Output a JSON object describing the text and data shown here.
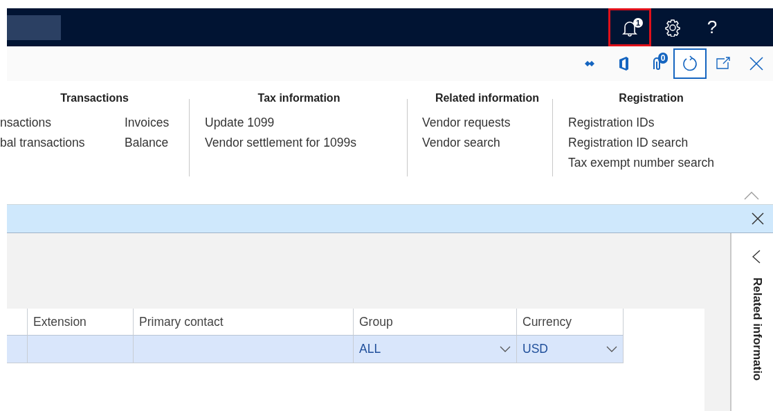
{
  "nav_bar": {
    "buttons": [
      {
        "kind": "notifications",
        "badge": "1",
        "highlighted": true
      },
      {
        "kind": "settings",
        "highlighted": false
      },
      {
        "kind": "help",
        "label": "?",
        "highlighted": false
      }
    ]
  },
  "action_bar": {
    "buttons": [
      {
        "kind": "diamond",
        "focused": false
      },
      {
        "kind": "office",
        "focused": false
      },
      {
        "kind": "attachments",
        "badge": "0",
        "focused": false
      },
      {
        "kind": "refresh",
        "focused": true
      },
      {
        "kind": "popout",
        "focused": false
      },
      {
        "kind": "close",
        "focused": false
      }
    ]
  },
  "menu": {
    "groups": [
      {
        "title": "Transactions",
        "columns": [
          [
            "nsactions",
            "bal transactions"
          ],
          [
            "Invoices",
            "Balance"
          ]
        ]
      },
      {
        "title": "Tax information",
        "columns": [
          [
            "Update 1099",
            "Vendor settlement for 1099s"
          ]
        ]
      },
      {
        "title": "Related information",
        "columns": [
          [
            "Vendor requests",
            "Vendor search"
          ]
        ]
      },
      {
        "title": "Registration",
        "columns": [
          [
            "Registration IDs",
            "Registration ID search",
            "Tax exempt number search"
          ]
        ]
      }
    ],
    "expanded": true
  },
  "message_bar": {
    "closable": true
  },
  "grid": {
    "columns": [
      {},
      {
        "label": "Extension"
      },
      {
        "label": "Primary contact"
      },
      {
        "label": "Group"
      },
      {
        "label": "Currency"
      }
    ],
    "rows": [
      {
        "selected": true,
        "cells": [
          {
            "kind": "text"
          },
          {
            "kind": "text"
          },
          {
            "kind": "text"
          },
          {
            "kind": "dropdown",
            "value": "ALL"
          },
          {
            "kind": "dropdown",
            "value": "USD"
          }
        ]
      }
    ]
  },
  "side_panel": {
    "title": "Related informatio",
    "expanded": false
  }
}
